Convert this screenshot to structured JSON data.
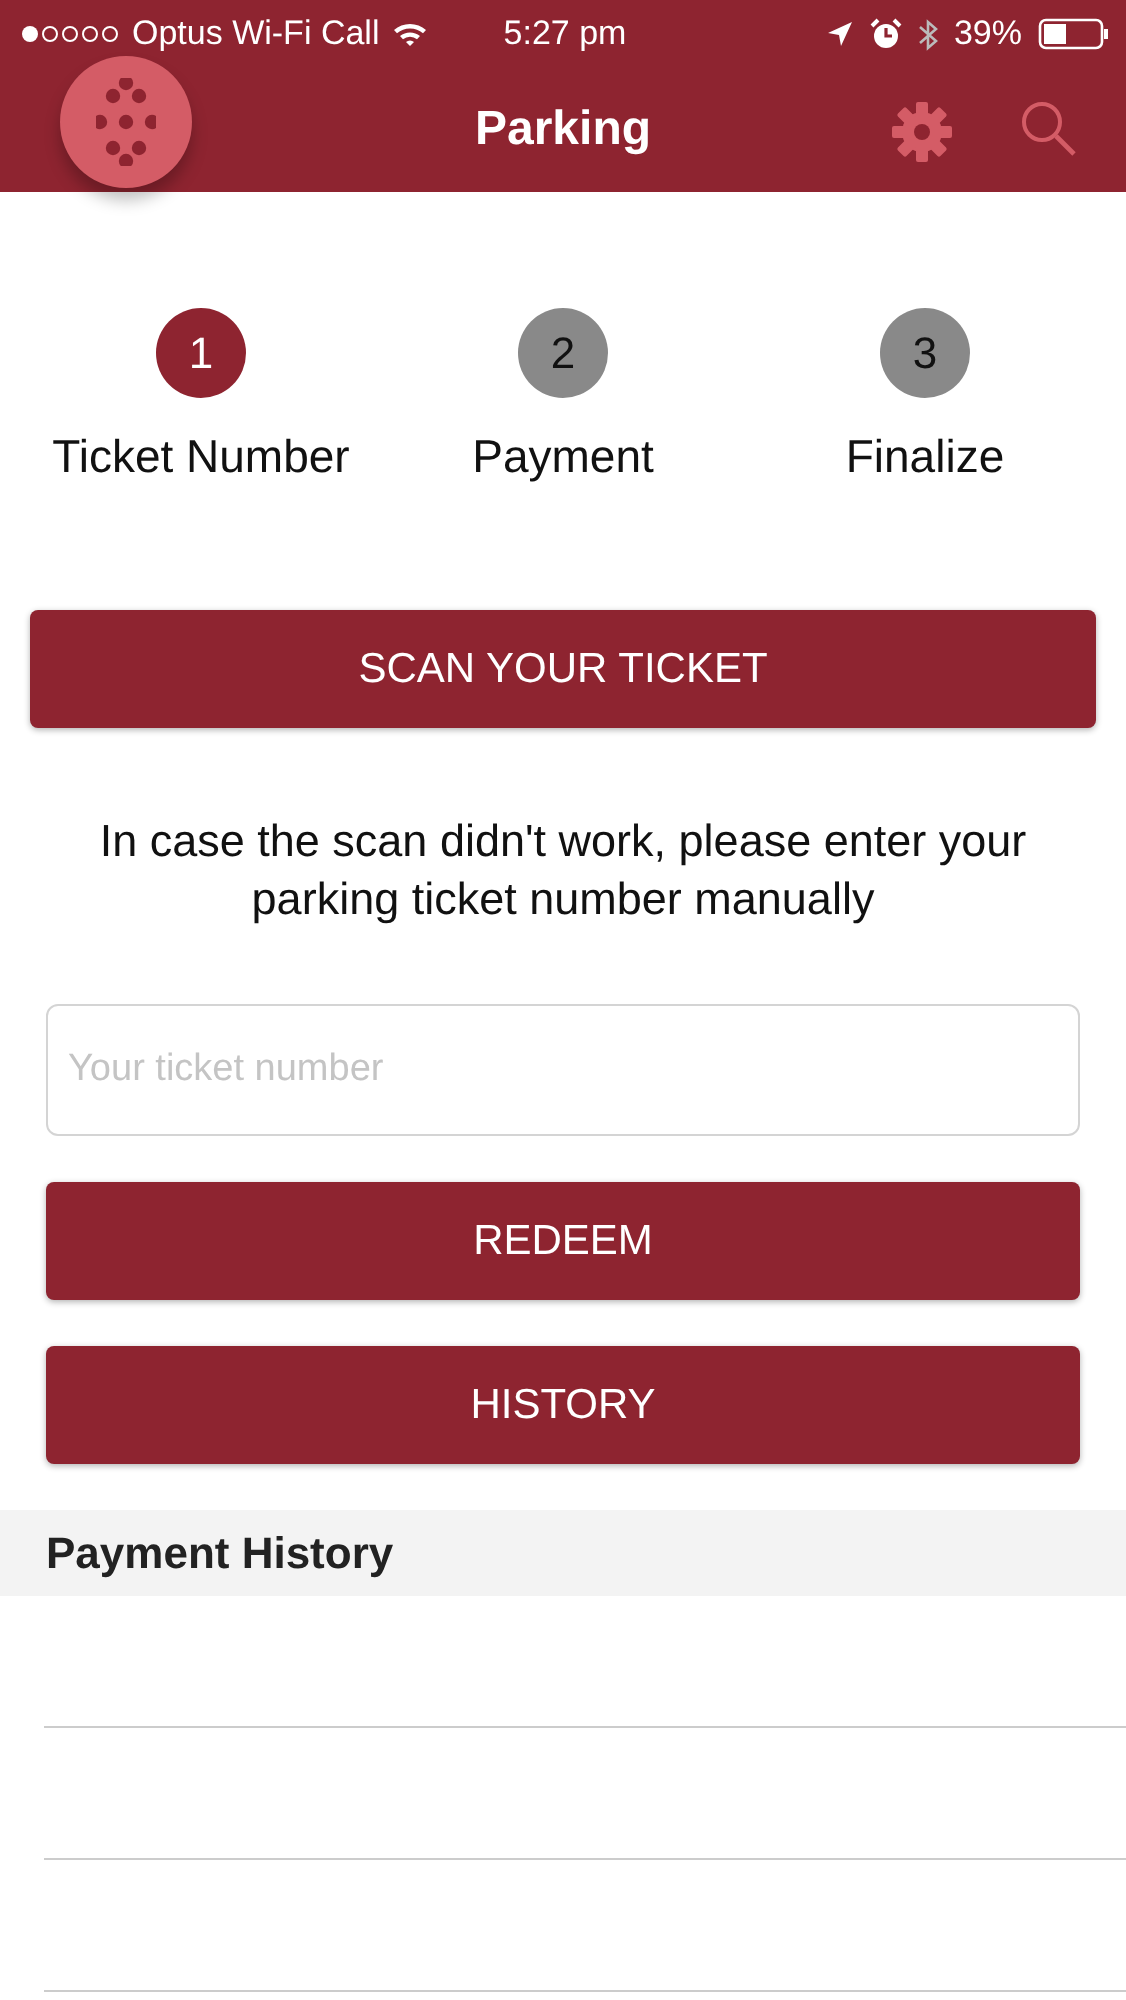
{
  "status_bar": {
    "carrier": "Optus Wi-Fi Call",
    "time": "5:27 pm",
    "battery": "39%"
  },
  "header": {
    "title": "Parking"
  },
  "steps": [
    {
      "number": "1",
      "label": "Ticket Number",
      "active": true
    },
    {
      "number": "2",
      "label": "Payment",
      "active": false
    },
    {
      "number": "3",
      "label": "Finalize",
      "active": false
    }
  ],
  "scan_button": "SCAN YOUR TICKET",
  "instructions": "In case the scan didn't work, please enter your parking ticket number manually",
  "ticket_field": {
    "placeholder": "Your ticket number"
  },
  "buttons": [
    "REDEEM",
    "HISTORY"
  ],
  "payment_history": {
    "title": "Payment History"
  }
}
